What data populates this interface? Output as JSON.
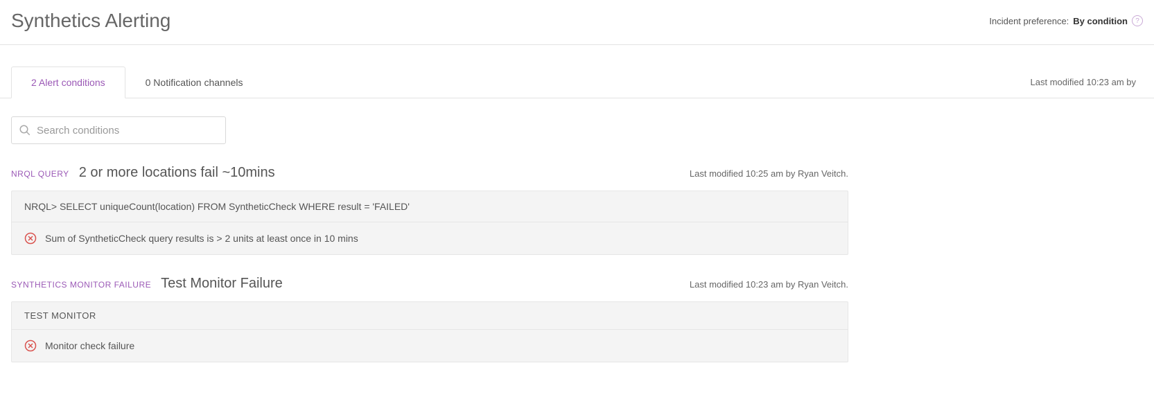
{
  "header": {
    "title": "Synthetics Alerting",
    "incident_preference_label": "Incident preference:",
    "incident_preference_value": "By condition"
  },
  "tabs": {
    "alert_conditions": "2 Alert conditions",
    "notification_channels": "0 Notification channels",
    "last_modified": "Last modified 10:23 am by"
  },
  "search": {
    "placeholder": "Search conditions"
  },
  "conditions": [
    {
      "type_label": "NRQL QUERY",
      "title": "2 or more locations fail ~10mins",
      "last_modified": "Last modified 10:25 am by Ryan Veitch.",
      "query": "NRQL> SELECT uniqueCount(location) FROM SyntheticCheck WHERE result = 'FAILED'",
      "threshold": "Sum of SyntheticCheck query results is > 2 units at least once in 10 mins"
    },
    {
      "type_label": "SYNTHETICS MONITOR FAILURE",
      "title": "Test Monitor Failure",
      "last_modified": "Last modified 10:23 am by Ryan Veitch.",
      "subhead": "TEST MONITOR",
      "threshold": "Monitor check failure"
    }
  ],
  "colors": {
    "accent": "#9b59b6",
    "critical": "#d9534f"
  }
}
